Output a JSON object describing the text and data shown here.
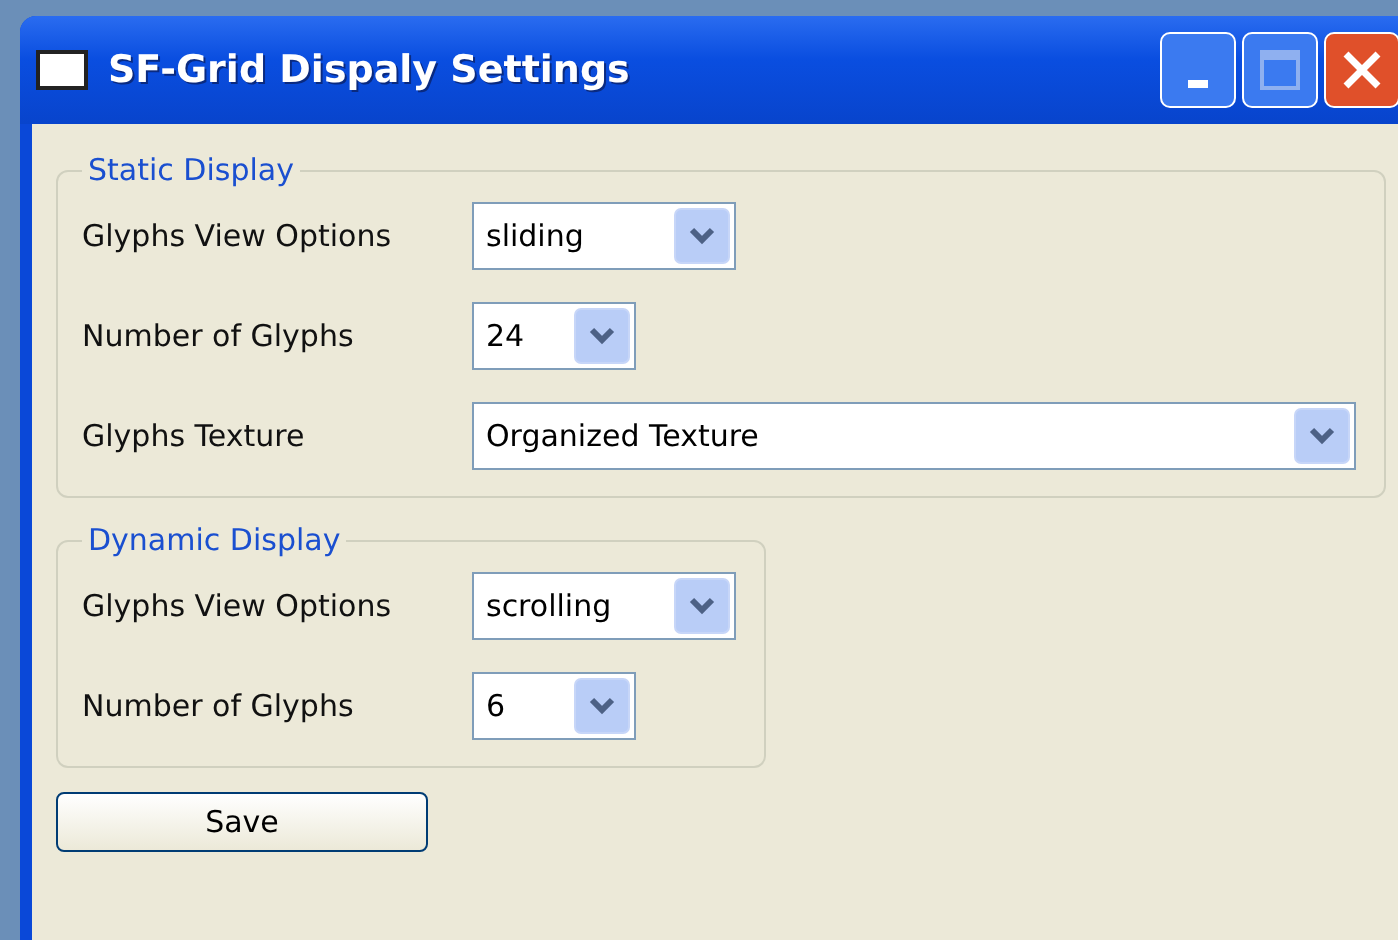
{
  "window": {
    "title": "SF-Grid Dispaly Settings"
  },
  "groups": [
    {
      "title": "Static Display",
      "rows": [
        {
          "label": "Glyphs View Options",
          "value": "sliding"
        },
        {
          "label": "Number of Glyphs",
          "value": "24"
        },
        {
          "label": "Glyphs Texture",
          "value": "Organized Texture"
        }
      ]
    },
    {
      "title": "Dynamic Display",
      "rows": [
        {
          "label": "Glyphs View Options",
          "value": "scrolling"
        },
        {
          "label": "Number of Glyphs",
          "value": "6"
        }
      ]
    }
  ],
  "buttons": [
    {
      "label": "Save"
    }
  ]
}
